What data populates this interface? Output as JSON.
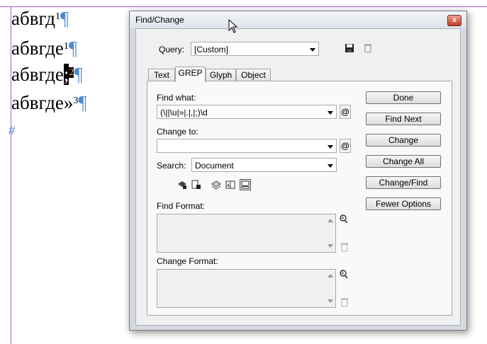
{
  "document": {
    "lines": [
      {
        "text": "абвгд",
        "sup": "1",
        "pilcrow": "¶"
      },
      {
        "text": "абвгде",
        "sup": "1",
        "pilcrow": "¶"
      },
      {
        "text": "абвгде",
        "selected_char": ";",
        "sup": "2",
        "pilcrow": "¶"
      },
      {
        "text": "абвгде»",
        "sup": "3",
        "pilcrow": "¶"
      }
    ],
    "end_marker": "#"
  },
  "dialog": {
    "title": "Find/Change",
    "close_label": "x",
    "query_label": "Query:",
    "query_value": "[Custom]",
    "tabs": [
      "Text",
      "GREP",
      "Glyph",
      "Object"
    ],
    "active_tab": "GREP",
    "find_what_label": "Find what:",
    "find_what_value": "(\\||\\u|»|.|,|;)\\d",
    "change_to_label": "Change to:",
    "change_to_value": "",
    "search_label": "Search:",
    "search_value": "Document",
    "find_format_label": "Find Format:",
    "change_format_label": "Change Format:",
    "at_symbol": "@",
    "buttons": [
      "Done",
      "Find Next",
      "Change",
      "Change All",
      "Change/Find",
      "Fewer Options"
    ]
  }
}
